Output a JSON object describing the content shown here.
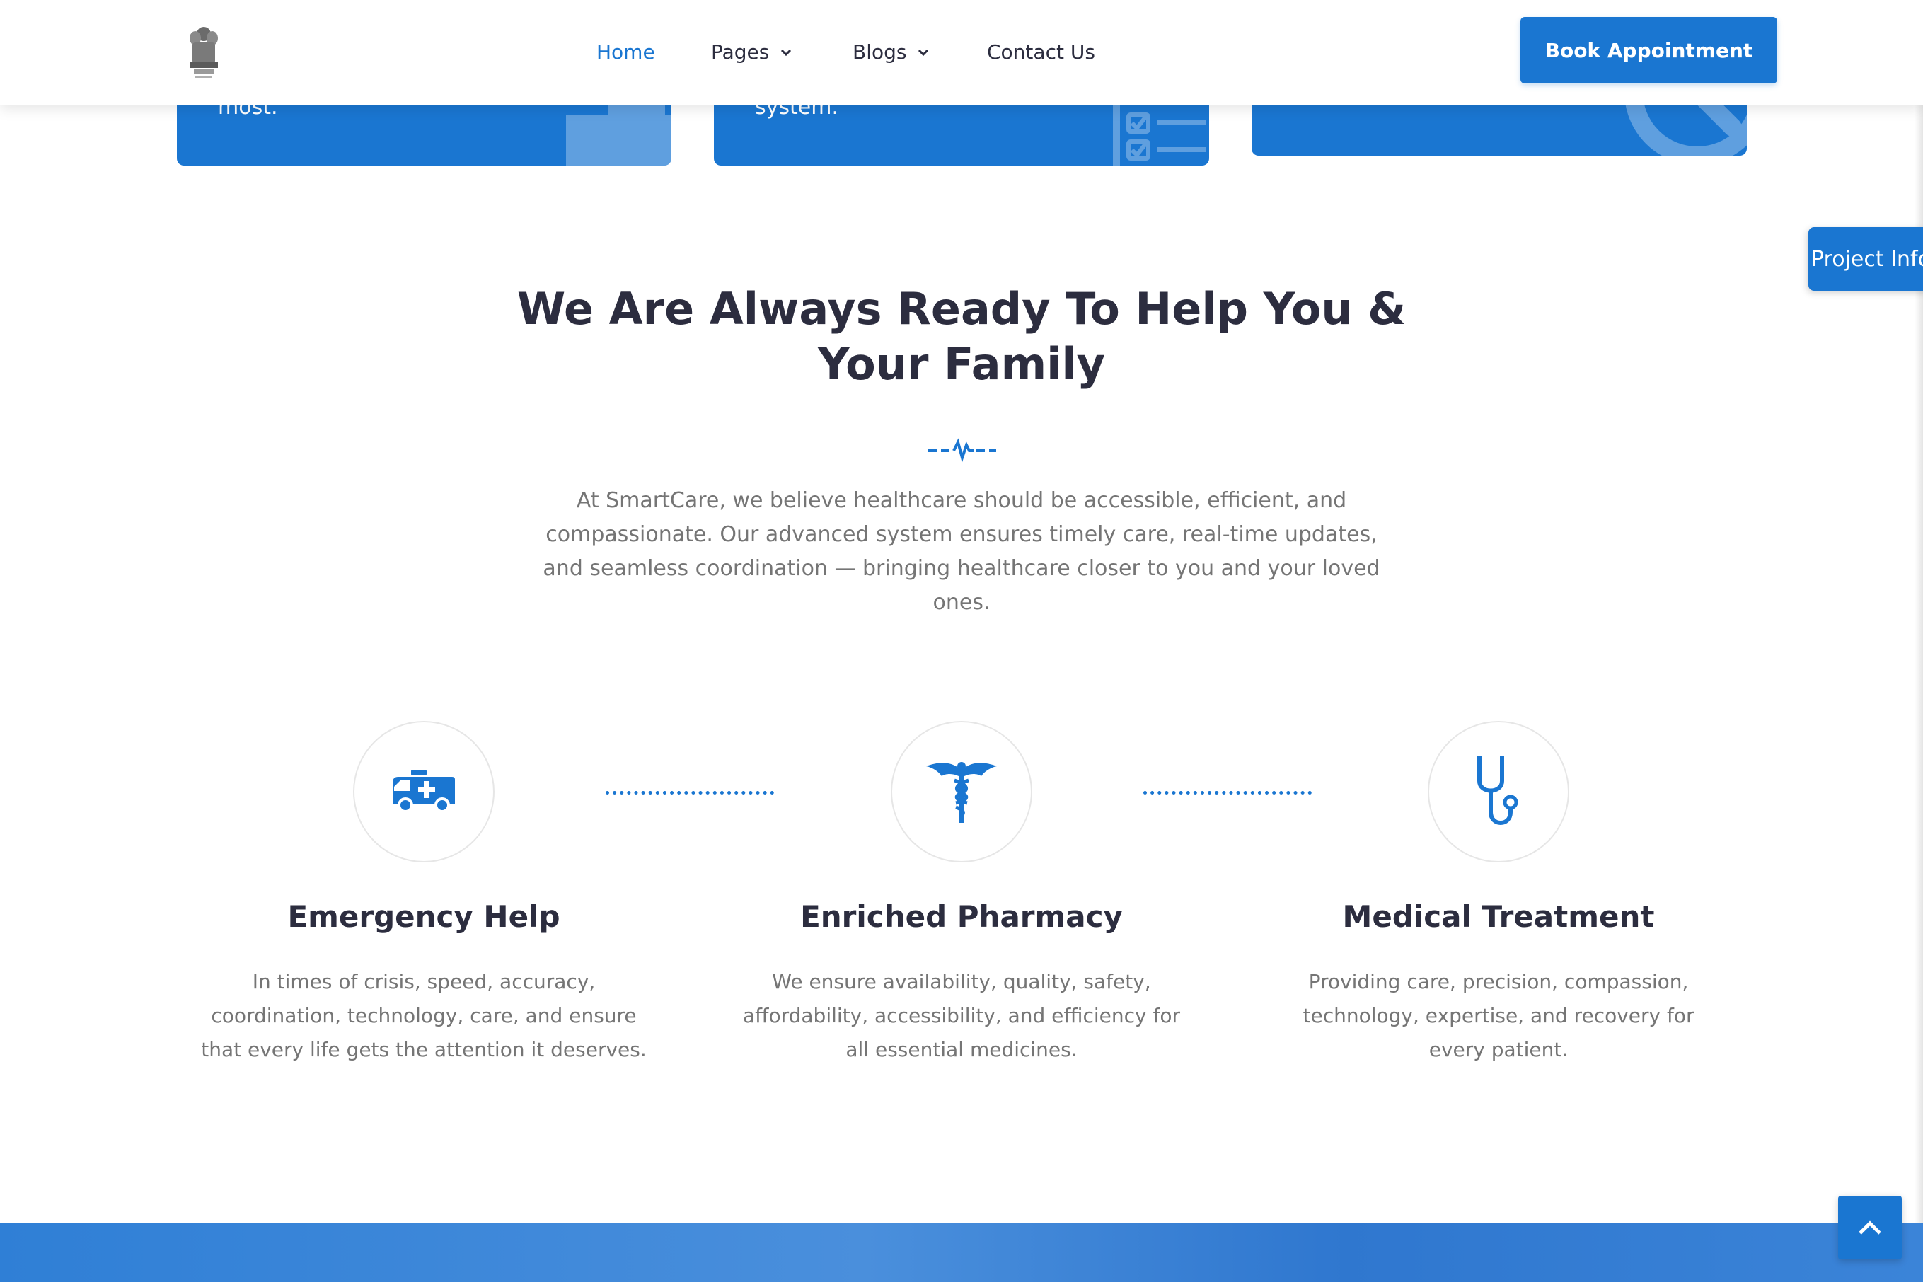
{
  "header": {
    "logo_icon": "national-emblem-icon",
    "nav": [
      {
        "label": "Home",
        "active": true
      },
      {
        "label": "Pages",
        "has_dropdown": true
      },
      {
        "label": "Blogs",
        "has_dropdown": true
      },
      {
        "label": "Contact Us"
      }
    ],
    "cta_label": "Book Appointment"
  },
  "top_cards": [
    {
      "text": "most.",
      "icon": "ambulance-icon"
    },
    {
      "text": "system.",
      "icon": "checklist-icon"
    },
    {
      "text": "",
      "icon": "clock-icon"
    }
  ],
  "project_info_label": "Project Info",
  "intro": {
    "title_line1": "We Are Always Ready To Help You &",
    "title_line2": "Your Family",
    "divider_icon": "heartbeat-icon",
    "description": "At SmartCare, we believe healthcare should be accessible, efficient, and compassionate. Our advanced system ensures timely care, real-time updates, and seamless coordination — bringing healthcare closer to you and your loved ones."
  },
  "features": [
    {
      "icon": "ambulance-icon",
      "title": "Emergency Help",
      "text": "In times of crisis, speed, accuracy, coordination, technology, care, and ensure that every life gets the attention it deserves."
    },
    {
      "icon": "caduceus-icon",
      "title": "Enriched Pharmacy",
      "text": "We ensure availability, quality, safety, affordability, accessibility, and efficiency for all essential medicines."
    },
    {
      "icon": "stethoscope-icon",
      "title": "Medical Treatment",
      "text": "Providing care, precision, compassion, technology, expertise, and recovery for every patient."
    }
  ],
  "scroll_top_icon": "chevron-up-icon",
  "colors": {
    "primary": "#1a76d1",
    "heading": "#2c2d3f",
    "body_text": "#757575"
  }
}
